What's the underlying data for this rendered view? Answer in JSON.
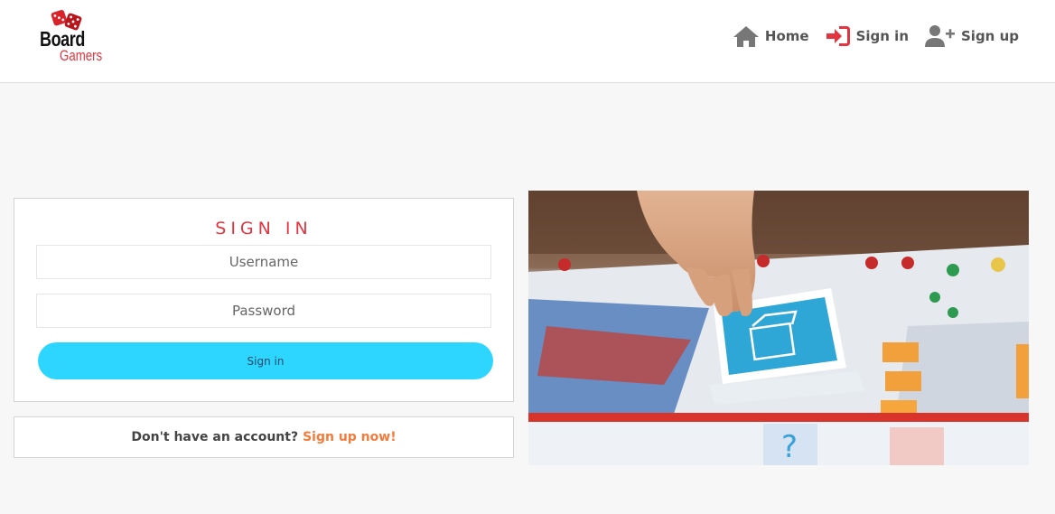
{
  "header": {
    "logo": {
      "line1": "Board",
      "line2": "Gamers"
    },
    "nav": [
      {
        "label": "Home",
        "icon": "home-icon"
      },
      {
        "label": "Sign in",
        "icon": "sign-in-icon"
      },
      {
        "label": "Sign up",
        "icon": "user-plus-icon"
      }
    ]
  },
  "signin": {
    "title": "SIGN IN",
    "username_placeholder": "Username",
    "password_placeholder": "Password",
    "button_label": "Sign in"
  },
  "signup_prompt": {
    "question": "Don't have an account?",
    "link": "Sign up now!"
  },
  "colors": {
    "brand_red": "#e2353f",
    "button_cyan": "#2dd6ff",
    "link_orange": "#f57b3b",
    "background": "#f7f7f7"
  },
  "hero_image": {
    "description_icon": "board-game-photo"
  }
}
